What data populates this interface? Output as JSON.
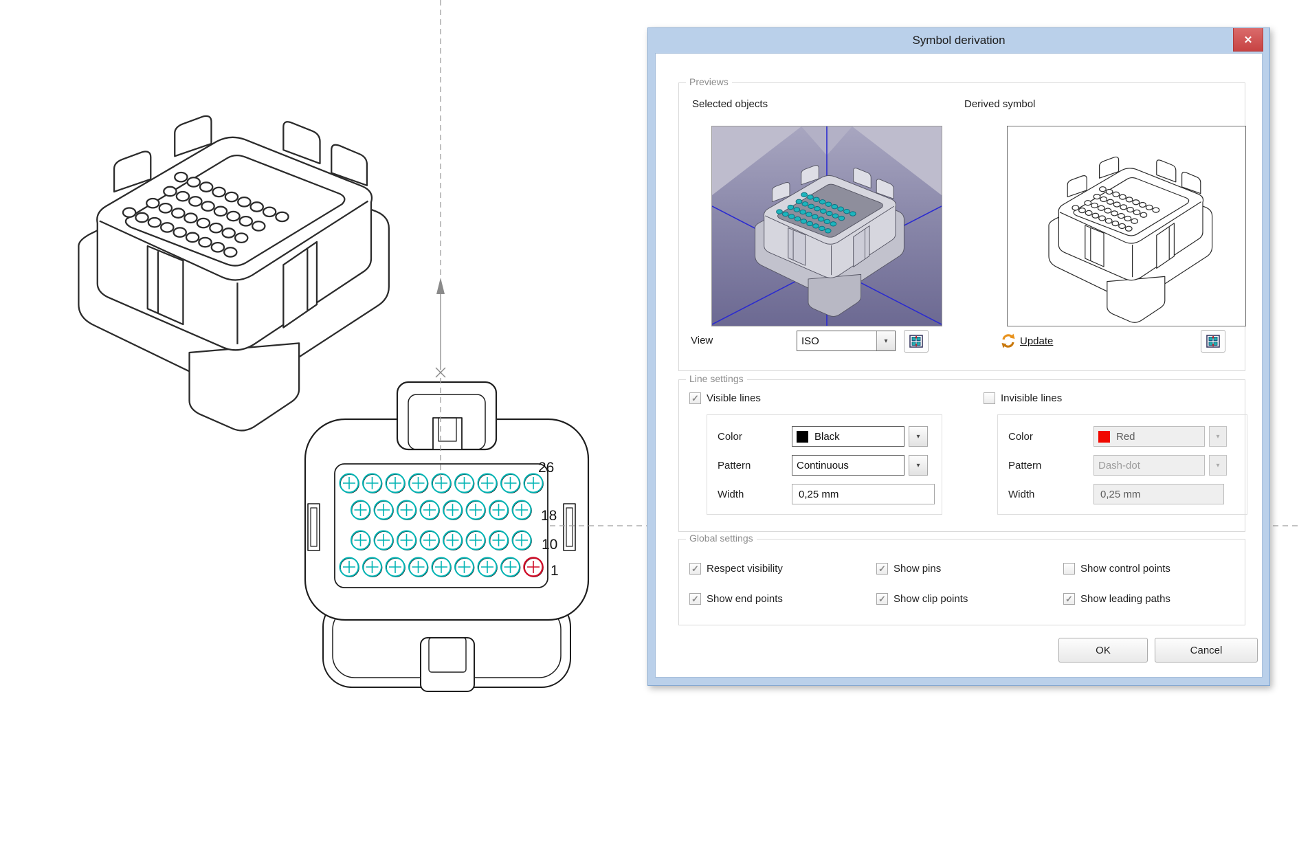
{
  "icons": {
    "close": "✕",
    "dropdown": "▾",
    "check": "✓"
  },
  "canvas": {
    "pin_numbers": [
      "26",
      "18",
      "10",
      "1"
    ]
  },
  "dialog": {
    "title": "Symbol derivation",
    "previews": {
      "label": "Previews",
      "selected_objects_label": "Selected objects",
      "derived_symbol_label": "Derived symbol",
      "view_label": "View",
      "view_value": "ISO",
      "update_label": "Update"
    },
    "line_settings": {
      "label": "Line settings",
      "visible": {
        "checkbox_label": "Visible lines",
        "checked": true,
        "glyph": "✓",
        "color_label": "Color",
        "color_value": "Black",
        "color_hex": "#000000",
        "pattern_label": "Pattern",
        "pattern_value": "Continuous",
        "width_label": "Width",
        "width_value": "0,25 mm"
      },
      "invisible": {
        "checkbox_label": "Invisible lines",
        "checked": false,
        "glyph": "",
        "color_label": "Color",
        "color_value": "Red",
        "color_hex": "#f00800",
        "pattern_label": "Pattern",
        "pattern_value": "Dash-dot",
        "width_label": "Width",
        "width_value": "0,25 mm"
      }
    },
    "global_settings": {
      "label": "Global settings",
      "checkboxes": [
        {
          "label": "Respect visibility",
          "checked": true,
          "glyph": "✓"
        },
        {
          "label": "Show pins",
          "checked": true,
          "glyph": "✓"
        },
        {
          "label": "Show control points",
          "checked": false,
          "glyph": ""
        },
        {
          "label": "Show end points",
          "checked": true,
          "glyph": "✓"
        },
        {
          "label": "Show clip points",
          "checked": true,
          "glyph": "✓"
        },
        {
          "label": "Show leading paths",
          "checked": true,
          "glyph": "✓"
        }
      ]
    },
    "buttons": {
      "ok": "OK",
      "cancel": "Cancel"
    }
  },
  "colors": {
    "dialog_frame": "#bad0ea",
    "close_red": "#c74343",
    "pin_teal": "#00b4b4",
    "pin_red": "#cf0d28",
    "axis_blue": "#2b2bd0",
    "centerline_gray": "#9f9f9f"
  }
}
